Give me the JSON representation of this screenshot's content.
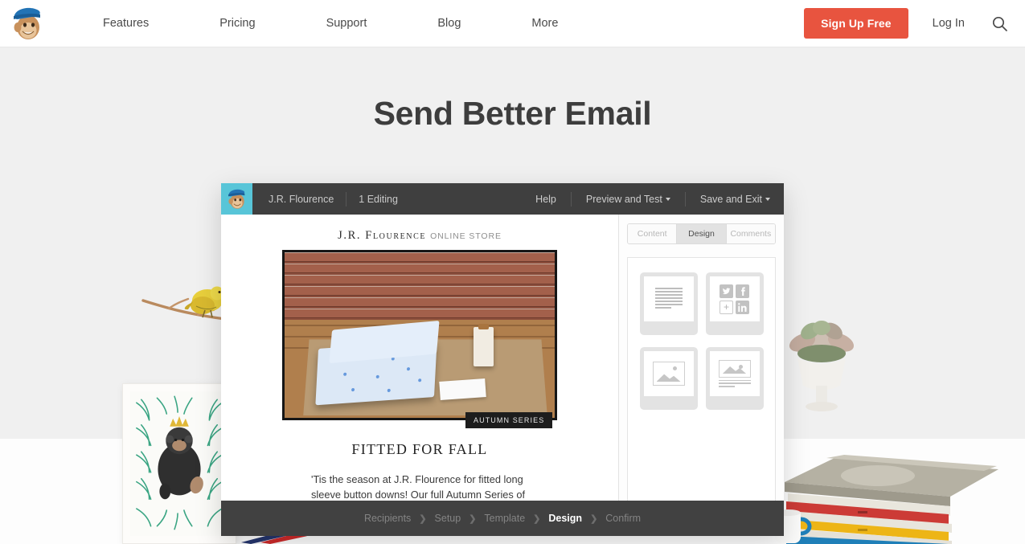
{
  "nav": {
    "logo_icon": "mailchimp-freddie-logo",
    "links": [
      {
        "label": "Features"
      },
      {
        "label": "Pricing"
      },
      {
        "label": "Support"
      },
      {
        "label": "Blog"
      },
      {
        "label": "More"
      }
    ],
    "signup_label": "Sign Up Free",
    "login_label": "Log In",
    "search_icon": "search-icon",
    "accent_color": "#e8543f"
  },
  "hero": {
    "title": "Send Better Email"
  },
  "app": {
    "toolbar": {
      "logo_icon": "mailchimp-freddie-logo",
      "campaign_name": "J.R. Flourence",
      "editing_status": "1 Editing",
      "help_label": "Help",
      "preview_label": "Preview and Test",
      "save_exit_label": "Save and Exit"
    },
    "tabs": [
      {
        "label": "Content",
        "active": false
      },
      {
        "label": "Design",
        "active": true
      },
      {
        "label": "Comments",
        "active": false
      }
    ],
    "email": {
      "brand": "J.R. Flourence",
      "store_label": "ONLINE STORE",
      "image_badge": "AUTUMN SERIES",
      "heading": "FITTED FOR FALL",
      "body": "'Tis the season at J.R. Flourence for fitted long sleeve button downs! Our full Autumn Series of"
    },
    "blocks": [
      {
        "name": "text-block",
        "icon": "text-lines-icon"
      },
      {
        "name": "social-share-block",
        "icon": "social-icons"
      },
      {
        "name": "image-block",
        "icon": "image-icon"
      },
      {
        "name": "image-caption-block",
        "icon": "image-caption-icon"
      }
    ],
    "social_icons": [
      "twitter",
      "facebook",
      "plus",
      "linkedin"
    ],
    "wizard": [
      {
        "label": "Recipients",
        "active": false
      },
      {
        "label": "Setup",
        "active": false
      },
      {
        "label": "Template",
        "active": false
      },
      {
        "label": "Design",
        "active": true
      },
      {
        "label": "Confirm",
        "active": false
      }
    ],
    "wizard_separator": "❯"
  },
  "scene": {
    "bird_prop": "yellow-bird-on-branch",
    "frame_prop": "framed-monkey-fern-print",
    "succulent_prop": "succulent-in-white-pedestal-bowl",
    "books_prop": "stack-of-books",
    "mug_prop": "white-mug",
    "pencils_prop": "colored-pencils"
  }
}
